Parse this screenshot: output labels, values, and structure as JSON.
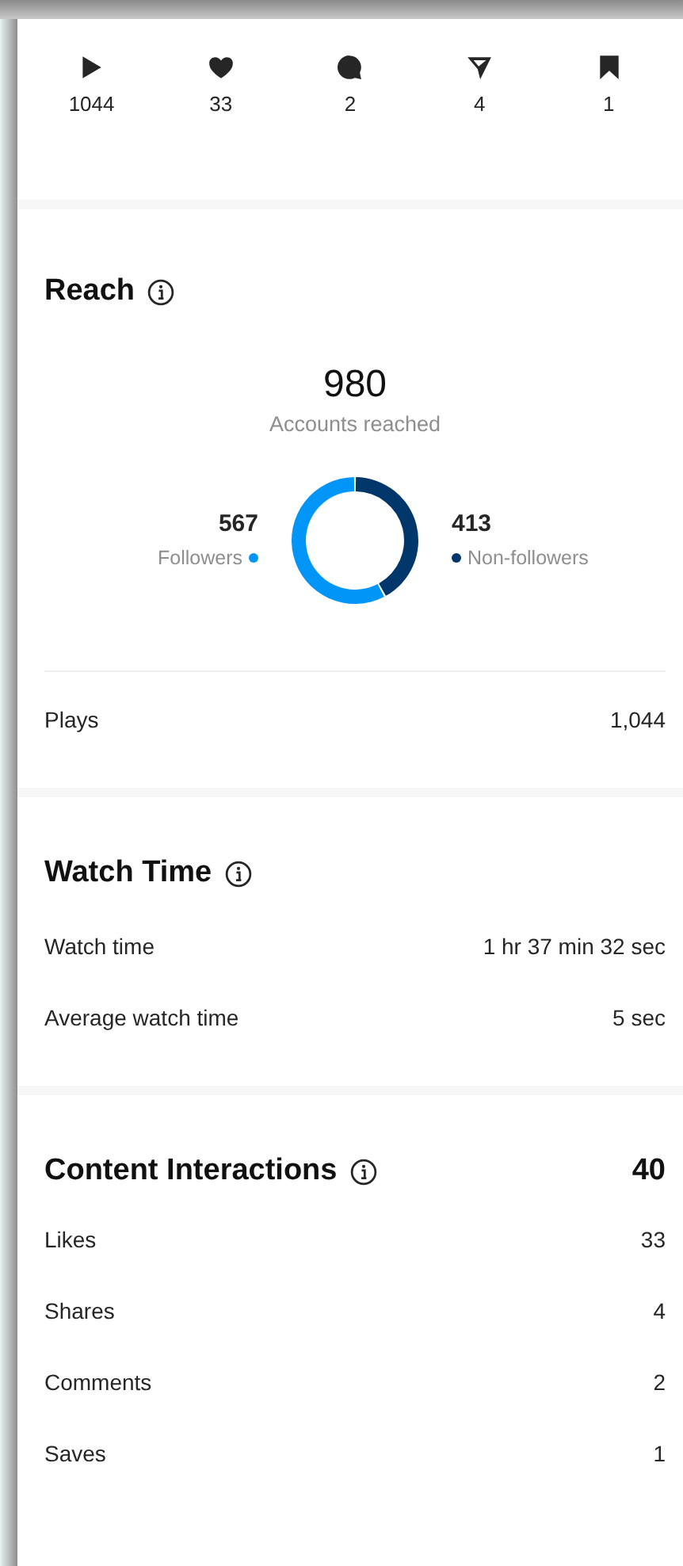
{
  "stats": [
    {
      "kind": "play",
      "value": "1044"
    },
    {
      "kind": "heart",
      "value": "33"
    },
    {
      "kind": "comment",
      "value": "2"
    },
    {
      "kind": "share",
      "value": "4"
    },
    {
      "kind": "save",
      "value": "1"
    }
  ],
  "reach": {
    "title": "Reach",
    "total": "980",
    "total_label": "Accounts reached",
    "legend": [
      {
        "value": "567",
        "label": "Followers",
        "color": "#0095f6"
      },
      {
        "value": "413",
        "label": "Non-followers",
        "color": "#00376b"
      }
    ],
    "rows": [
      {
        "label": "Plays",
        "value": "1,044"
      }
    ]
  },
  "watch_time": {
    "title": "Watch Time",
    "rows": [
      {
        "label": "Watch time",
        "value": "1 hr 37 min 32 sec"
      },
      {
        "label": "Average watch time",
        "value": "5 sec"
      }
    ]
  },
  "interactions": {
    "title": "Content Interactions",
    "total": "40",
    "rows": [
      {
        "label": "Likes",
        "value": "33"
      },
      {
        "label": "Shares",
        "value": "4"
      },
      {
        "label": "Comments",
        "value": "2"
      },
      {
        "label": "Saves",
        "value": "1"
      }
    ]
  }
}
